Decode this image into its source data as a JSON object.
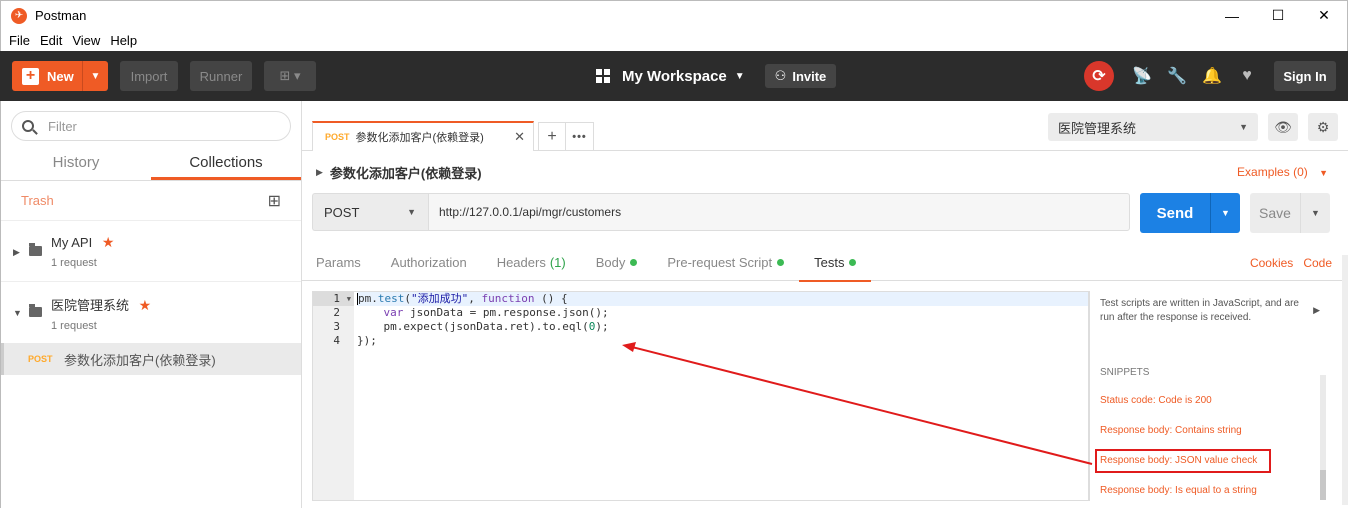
{
  "window": {
    "title": "Postman",
    "controls": {
      "minimize": "—",
      "maximize": "☐",
      "close": "✕"
    }
  },
  "menu": [
    "File",
    "Edit",
    "View",
    "Help"
  ],
  "toolbar": {
    "new_label": "New",
    "import_label": "Import",
    "runner_label": "Runner",
    "workspace": "My Workspace",
    "invite_label": "Invite",
    "signin_label": "Sign In",
    "icons": [
      "sync-icon",
      "satellite-icon",
      "wrench-icon",
      "bell-icon",
      "heart-icon"
    ]
  },
  "sidebar": {
    "filter_placeholder": "Filter",
    "tabs": {
      "history": "History",
      "collections": "Collections"
    },
    "trash_label": "Trash",
    "collections": [
      {
        "name": "My API",
        "count": "1 request",
        "starred": true
      },
      {
        "name": "医院管理系统",
        "count": "1 request",
        "starred": true
      }
    ],
    "request": {
      "method": "POST",
      "name": "参数化添加客户(依赖登录)"
    }
  },
  "request_tab": {
    "method": "POST",
    "name": "参数化添加客户(依赖登录)",
    "close": "✕",
    "add": "+",
    "more": "•••"
  },
  "environment": {
    "selected": "医院管理系统"
  },
  "request": {
    "title": "参数化添加客户(依赖登录)",
    "examples_label": "Examples (0)",
    "method": "POST",
    "url": "http://127.0.0.1/api/mgr/customers",
    "send_label": "Send",
    "save_label": "Save"
  },
  "sub_tabs": {
    "params": "Params",
    "authorization": "Authorization",
    "headers": "Headers",
    "headers_count": "(1)",
    "body": "Body",
    "prerequest": "Pre-request Script",
    "tests": "Tests",
    "cookies": "Cookies",
    "code": "Code"
  },
  "editor": {
    "line_numbers": [
      "1",
      "2",
      "3",
      "4"
    ],
    "lines": {
      "l1_a": "pm.",
      "l1_b": "test",
      "l1_c": "(",
      "l1_d": "\"添加成功\"",
      "l1_e": ", ",
      "l1_f": "function",
      "l1_g": " () {",
      "l2_a": "    ",
      "l2_b": "var",
      "l2_c": " jsonData = pm.response.json();",
      "l3_a": "    pm.expect(jsonData.ret).to.eql(",
      "l3_b": "0",
      "l3_c": ");",
      "l4": "});"
    }
  },
  "snippets": {
    "description": "Test scripts are written in JavaScript, and are run after the response is received.",
    "heading": "SNIPPETS",
    "items": [
      "Status code: Code is 200",
      "Response body: Contains string",
      "Response body: JSON value check",
      "Response body: Is equal to a string"
    ]
  },
  "colors": {
    "accent": "#ef5b25",
    "send": "#1c81e4",
    "toolbar": "#2c2c2c",
    "annotation": "#e01b1b",
    "status_dot": "#3cba54"
  }
}
